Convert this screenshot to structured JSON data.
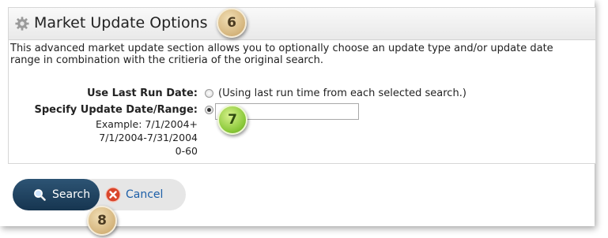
{
  "panel": {
    "title": "Market Update Options",
    "description": "This advanced market update section allows you to optionally choose an update type and/or update date range in combination with the critieria of the original search."
  },
  "options": {
    "last_run": {
      "label": "Use Last Run Date:",
      "hint": "(Using last run time from each selected search.)",
      "selected": false
    },
    "specify": {
      "label": "Specify Update Date/Range:",
      "selected": true,
      "value": "",
      "examples": [
        "Example: 7/1/2004+",
        "7/1/2004-7/31/2004",
        "0-60"
      ]
    }
  },
  "buttons": {
    "search_label": "Search",
    "cancel_label": "Cancel"
  },
  "badges": [
    "6",
    "7",
    "8"
  ],
  "icons": {
    "title": "gear-icon",
    "search": "magnifier-icon",
    "cancel": "cancel-x-icon"
  },
  "colors": {
    "search_button": "#1f4563",
    "cancel_link": "#1d5fa8",
    "step_badge": "#d4b47c",
    "step_badge_active": "#8bc93a"
  }
}
